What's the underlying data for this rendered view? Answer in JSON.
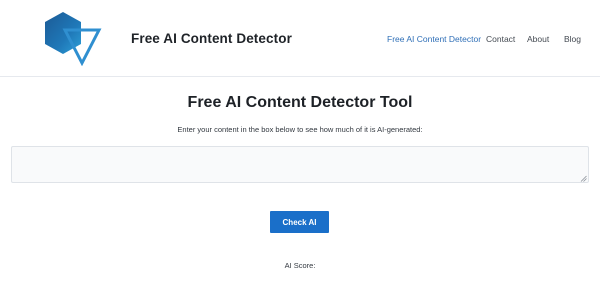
{
  "header": {
    "logo_icon": "hexagon-triangle-logo-icon",
    "site_title": "Free AI Content Detector",
    "nav": [
      {
        "label": "Free AI Content Detector",
        "active": true
      },
      {
        "label": "Contact",
        "active": false
      },
      {
        "label": "About",
        "active": false
      },
      {
        "label": "Blog",
        "active": false
      }
    ]
  },
  "main": {
    "title": "Free AI Content Detector Tool",
    "instructions": "Enter your content in the box below to see how much of it is AI-generated:",
    "content_input": {
      "value": "",
      "placeholder": ""
    },
    "check_button_label": "Check AI",
    "score_label": "AI Score:"
  },
  "colors": {
    "accent": "#1a6fc9",
    "nav_active": "#2f6fb7",
    "logo_dark": "#1e5f9e",
    "logo_light": "#2ea0d8"
  }
}
